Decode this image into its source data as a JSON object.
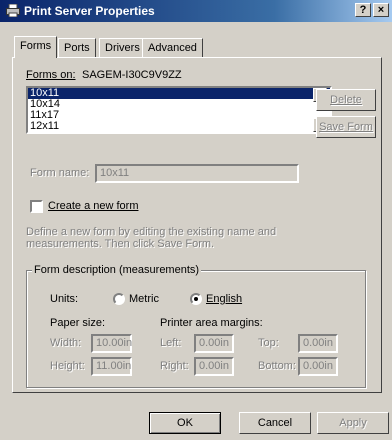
{
  "window": {
    "title": "Print Server Properties",
    "help_button": "?",
    "close_button": "×"
  },
  "tabs": [
    {
      "label": "Forms"
    },
    {
      "label": "Ports"
    },
    {
      "label": "Drivers"
    },
    {
      "label": "Advanced"
    }
  ],
  "forms": {
    "forms_on_label": "Forms on:",
    "server_name": "SAGEM-I30C9V9ZZ",
    "items": [
      "10x11",
      "10x14",
      "11x17",
      "12x11"
    ],
    "selected_index": 0,
    "delete_label": "Delete",
    "save_form_label": "Save Form",
    "form_name_label": "Form name:",
    "form_name_value": "10x11",
    "create_new_label": "Create a new form",
    "create_new_checked": false,
    "instructions": "Define a new form by editing the existing name and measurements.  Then click Save Form."
  },
  "description": {
    "title": "Form description (measurements)",
    "units_label": "Units:",
    "metric_label": "Metric",
    "english_label": "English",
    "selected_unit": "English",
    "paper_size_label": "Paper size:",
    "margins_label": "Printer area margins:",
    "width_label": "Width:",
    "width_value": "10.00in",
    "height_label": "Height:",
    "height_value": "11.00in",
    "left_label": "Left:",
    "left_value": "0.00in",
    "right_label": "Right:",
    "right_value": "0.00in",
    "top_label": "Top:",
    "top_value": "0.00in",
    "bottom_label": "Bottom:",
    "bottom_value": "0.00in"
  },
  "footer": {
    "ok_label": "OK",
    "cancel_label": "Cancel",
    "apply_label": "Apply"
  },
  "colors": {
    "titlebar_start": "#0a246a",
    "titlebar_end": "#a6caf0",
    "face": "#d4d0c8",
    "selection": "#0a246a",
    "disabled_text": "#808080"
  }
}
